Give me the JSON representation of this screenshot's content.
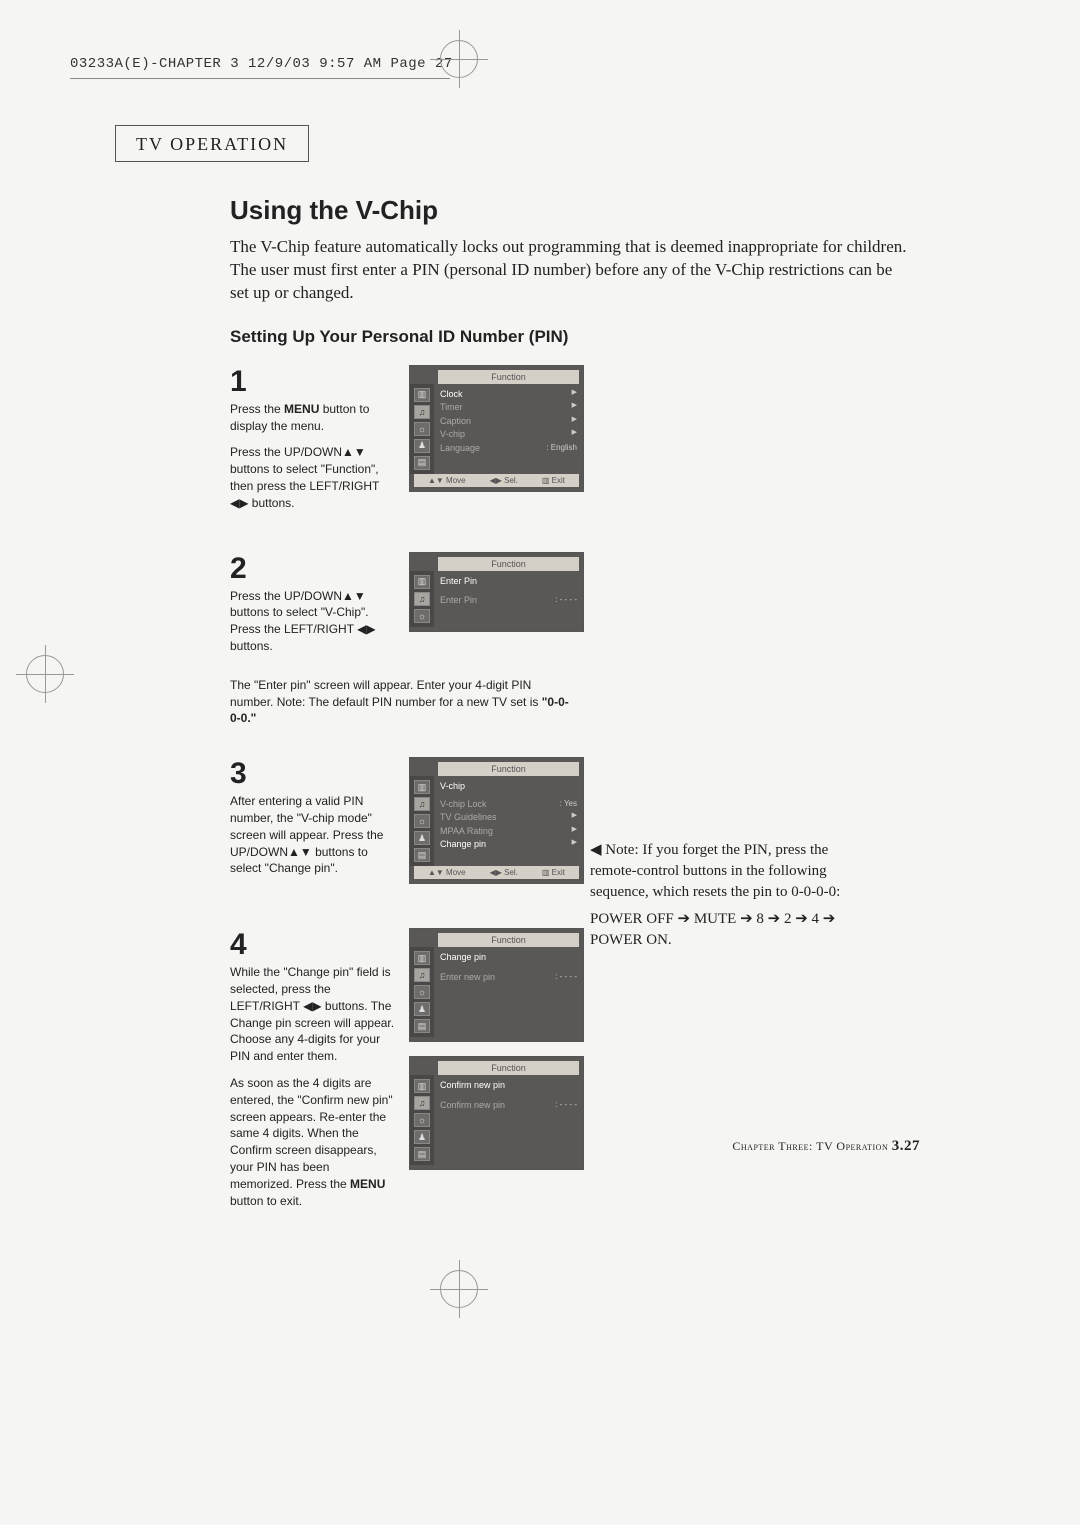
{
  "header_line": "03233A(E)-CHAPTER 3  12/9/03  9:57 AM  Page 27",
  "section_box": "TV OPERATION",
  "title": "Using the V-Chip",
  "intro": "The V-Chip feature automatically locks out programming that is deemed inappropriate for children. The user must first enter a PIN (personal ID number) before any of the V-Chip restrictions can be set up or changed.",
  "subhead": "Setting Up Your Personal ID Number (PIN)",
  "steps": {
    "s1": {
      "num": "1",
      "p1a": "Press the ",
      "p1b": "MENU",
      "p1c": " button to display the menu.",
      "p2": "Press the UP/DOWN▲▼ buttons to select \"Function\", then press the LEFT/RIGHT ◀▶ buttons."
    },
    "s2": {
      "num": "2",
      "p1": "Press the UP/DOWN▲▼ buttons to select \"V-Chip\". Press the LEFT/RIGHT ◀▶ buttons.",
      "under": "The \"Enter pin\" screen will appear. Enter your 4-digit PIN number. Note: The default PIN number for a new TV set is ",
      "pin": "\"0-0-0-0.\""
    },
    "s3": {
      "num": "3",
      "p1": "After entering a valid PIN number, the \"V-chip mode\" screen will appear. Press the UP/DOWN▲▼ buttons to select \"Change pin\"."
    },
    "s4": {
      "num": "4",
      "p1": "While the \"Change pin\" field is selected, press the LEFT/RIGHT ◀▶ buttons. The Change pin screen will appear. Choose any 4-digits for your PIN and enter them.",
      "p2a": "As soon as the 4 digits are entered, the \"Confirm new pin\" screen appears. Re-enter the same 4 digits. When the Confirm screen disappears, your PIN has been memorized. Press the ",
      "p2b": "MENU",
      "p2c": " button to exit."
    }
  },
  "osd": {
    "function_label": "Function",
    "foot_move": "▲▼ Move",
    "foot_sel": "◀▶ Sel.",
    "foot_exit": "▥ Exit",
    "s1": {
      "rows": [
        {
          "label": "Clock",
          "val": "▶",
          "sel": true
        },
        {
          "label": "Timer",
          "val": "▶"
        },
        {
          "label": "Caption",
          "val": "▶"
        },
        {
          "label": "V-chip",
          "val": "▶"
        },
        {
          "label": "Language",
          "val": ": English"
        }
      ]
    },
    "s2": {
      "title_row": "Enter Pin",
      "rows": [
        {
          "label": "Enter Pin",
          "val": ": - - - -"
        }
      ]
    },
    "s3": {
      "title_row": "V-chip",
      "rows": [
        {
          "label": "V-chip Lock",
          "val": ": Yes"
        },
        {
          "label": "TV Guidelines",
          "val": "▶"
        },
        {
          "label": "MPAA Rating",
          "val": "▶"
        },
        {
          "label": "Change pin",
          "val": "▶",
          "sel": true
        }
      ]
    },
    "s4a": {
      "title_row": "Change pin",
      "rows": [
        {
          "label": "Enter new pin",
          "val": ": - - - -"
        }
      ]
    },
    "s4b": {
      "title_row": "Confirm new pin",
      "rows": [
        {
          "label": "Confirm new pin",
          "val": ": - - - -"
        }
      ]
    }
  },
  "side_note": {
    "lead": "◀ Note: If you forget the PIN, press the remote-control buttons in the following sequence, which resets the pin to 0-0-0-0:",
    "seq": "POWER OFF ➔ MUTE ➔ 8 ➔ 2 ➔ 4 ➔ POWER ON."
  },
  "footer": {
    "text": "Chapter Three: TV Operation ",
    "pg": "3.27"
  }
}
